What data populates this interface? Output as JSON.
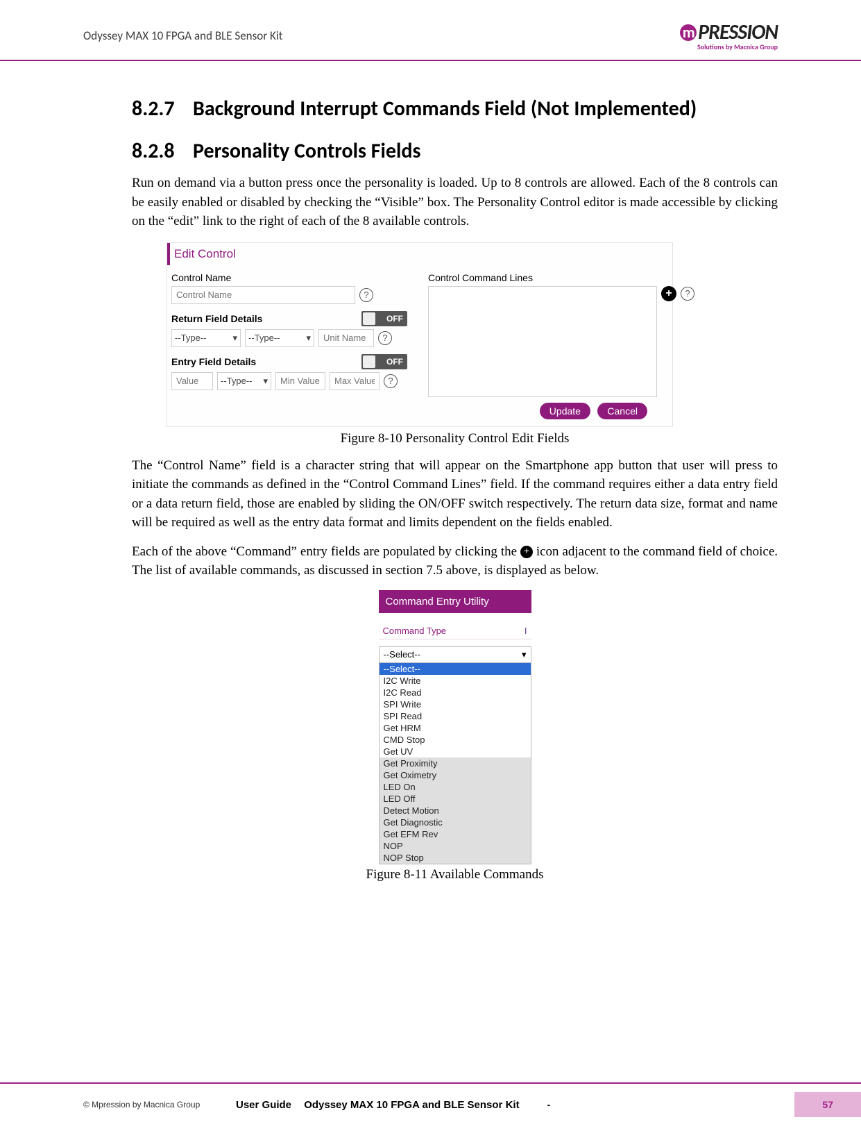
{
  "header": {
    "doc_title": "Odyssey MAX 10 FPGA and BLE Sensor Kit",
    "logo_text": "PRESSION",
    "logo_prefix": "m",
    "logo_sub": "Solutions by Macnica Group"
  },
  "sections": {
    "s1": {
      "num": "8.2.7",
      "title": "Background Interrupt Commands Field (Not Implemented)"
    },
    "s2": {
      "num": "8.2.8",
      "title": "Personality Controls Fields"
    }
  },
  "para1": "Run on demand via a button press once the personality is loaded.  Up to 8 controls are allowed.  Each of the 8 controls can be easily enabled or disabled by checking the “Visible” box.  The Personality Control editor is made accessible by clicking on the “edit” link to the right of each of the 8 available controls.",
  "fig1": {
    "heading": "Edit Control",
    "control_name_lbl": "Control Name",
    "control_name_ph": "Control Name",
    "return_lbl": "Return Field Details",
    "off": "OFF",
    "type_ph": "--Type--",
    "unit_ph": "Unit Name",
    "entry_lbl": "Entry Field Details",
    "value_ph": "Value",
    "min_ph": "Min Value",
    "max_ph": "Max Value",
    "ccl_lbl": "Control Command Lines",
    "update": "Update",
    "cancel": "Cancel",
    "caption": "Figure 8-10 Personality Control Edit Fields"
  },
  "para2": "The “Control Name” field is a character string that will appear on the Smartphone app button that user will press to initiate the commands as defined in the “Control Command Lines” field.  If the command requires either a data entry field or a data return field, those are enabled by sliding the ON/OFF switch respectively.  The return data size, format and name will be required as well as the entry data format and limits dependent on the fields enabled.",
  "para3a": "Each of the above “Command” entry fields are populated by clicking the ",
  "para3b": " icon adjacent to the command field of choice.  The list of available commands, as discussed in section 7.5 above, is displayed as below.",
  "fig2": {
    "title": "Command Entry Utility",
    "col_label": "Command Type",
    "col_i": "I",
    "selected": "--Select--",
    "options": [
      "--Select--",
      "I2C Write",
      "I2C Read",
      "SPI Write",
      "SPI Read",
      "Get HRM",
      "CMD Stop",
      "Get UV",
      "Get Proximity",
      "Get Oximetry",
      "LED On",
      "LED Off",
      "Detect Motion",
      "Get Diagnostic",
      "Get EFM Rev",
      "NOP",
      "NOP Stop"
    ],
    "caption": "Figure 8-11 Available Commands"
  },
  "footer": {
    "copy": "© Mpression by Macnica Group",
    "ug": "User Guide",
    "title": "Odyssey MAX 10 FPGA and BLE Sensor Kit",
    "dash": "-",
    "page": "57"
  }
}
